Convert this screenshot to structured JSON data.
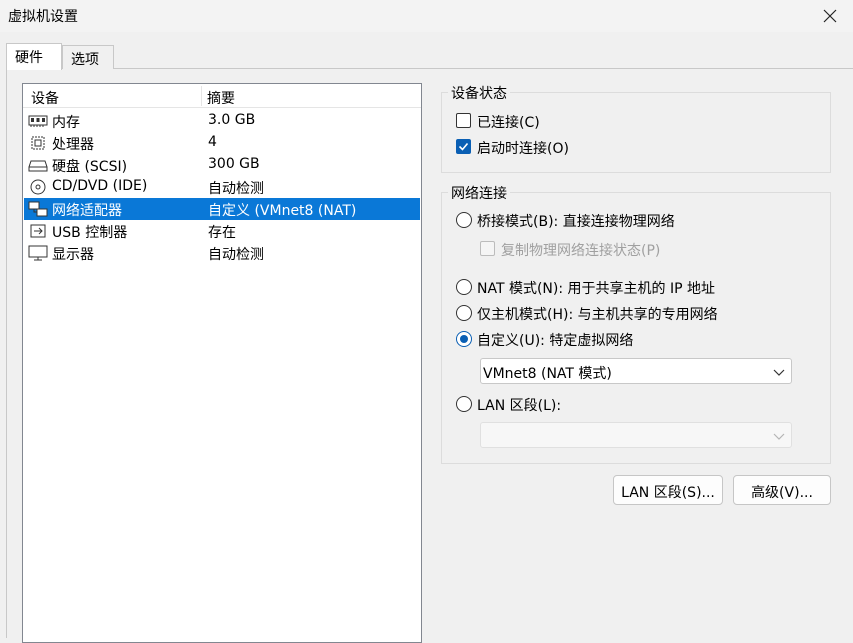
{
  "window": {
    "title": "虚拟机设置"
  },
  "tabs": [
    {
      "label": "硬件"
    },
    {
      "label": "选项"
    }
  ],
  "device_list": {
    "headers": {
      "device": "设备",
      "summary": "摘要"
    },
    "rows": [
      {
        "icon": "memory-icon",
        "name": "内存",
        "summary": "3.0 GB"
      },
      {
        "icon": "processor-icon",
        "name": "处理器",
        "summary": "4"
      },
      {
        "icon": "harddisk-icon",
        "name": "硬盘 (SCSI)",
        "summary": "300 GB"
      },
      {
        "icon": "cd-dvd-icon",
        "name": "CD/DVD (IDE)",
        "summary": "自动检测"
      },
      {
        "icon": "network-adapter-icon",
        "name": "网络适配器",
        "summary": "自定义 (VMnet8 (NAT)"
      },
      {
        "icon": "usb-icon",
        "name": "USB 控制器",
        "summary": "存在"
      },
      {
        "icon": "display-icon",
        "name": "显示器",
        "summary": "自动检测"
      }
    ],
    "selected_index": 4
  },
  "device_status": {
    "title": "设备状态",
    "connected": {
      "label": "已连接(C)",
      "checked": false
    },
    "connect_at_power_on": {
      "label": "启动时连接(O)",
      "checked": true
    }
  },
  "network_connection": {
    "title": "网络连接",
    "bridged": {
      "label": "桥接模式(B): 直接连接物理网络",
      "selected": false
    },
    "replicate": {
      "label": "复制物理网络连接状态(P)",
      "checked": false,
      "disabled": true
    },
    "nat": {
      "label": "NAT 模式(N): 用于共享主机的 IP 地址",
      "selected": false
    },
    "host_only": {
      "label": "仅主机模式(H): 与主机共享的专用网络",
      "selected": false
    },
    "custom": {
      "label": "自定义(U): 特定虚拟网络",
      "selected": true
    },
    "custom_select": {
      "value": "VMnet8 (NAT 模式)"
    },
    "lan_segment": {
      "label": "LAN 区段(L):",
      "selected": false
    },
    "lan_select": {
      "value": "",
      "disabled": true
    }
  },
  "buttons": {
    "lan_segments": "LAN 区段(S)...",
    "advanced": "高级(V)..."
  },
  "colors": {
    "selection": "#0a78d7",
    "accent": "#0a5fb4"
  }
}
